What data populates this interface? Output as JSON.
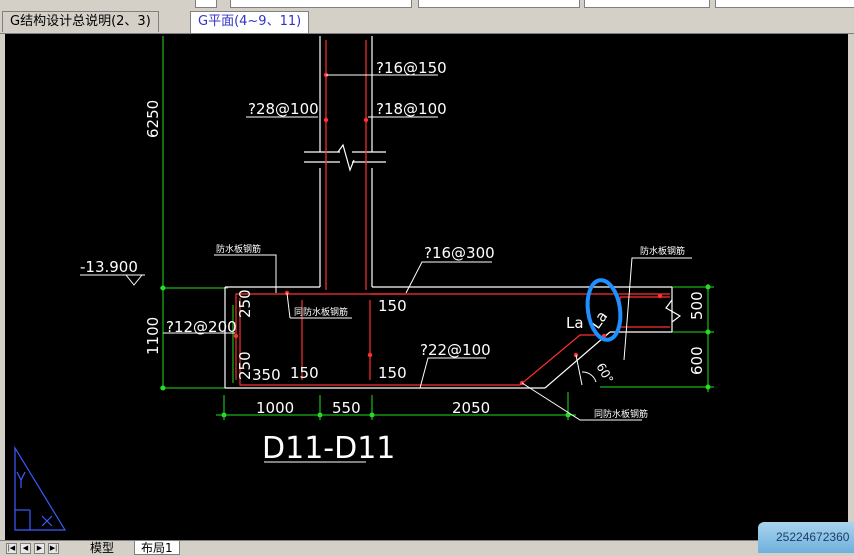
{
  "tabs": [
    {
      "label": "G结构设计总说明(2、3)",
      "active": false
    },
    {
      "label": "G平面(4~9、11)",
      "active": true
    }
  ],
  "drawing": {
    "title": "D11-D11",
    "level": "-13.900",
    "rebar": {
      "r16_150": "?16@150",
      "r28_100": "?28@100",
      "r18_100": "?18@100",
      "r16_300": "?16@300",
      "r12_200": "?12@200",
      "r22_100": "?22@100"
    },
    "dims": {
      "d6250": "6250",
      "d1100": "1100",
      "d250a": "250",
      "d250b": "250",
      "d350": "350",
      "d150a": "150",
      "d150b": "150",
      "d150c": "150",
      "d1000": "1000",
      "d550": "550",
      "d2050": "2050",
      "d500": "500",
      "d600": "600",
      "angle": "60°"
    },
    "labels": {
      "la1": "La",
      "la2": "La",
      "waterproof1": "防水板钢筋",
      "waterproof2": "防水板钢筋",
      "waterproof3": "同防水板钢筋",
      "waterproof4": "同防水板钢筋"
    }
  },
  "bottom_tabs": [
    {
      "label": "模型",
      "active": false
    },
    {
      "label": "布局1",
      "active": true
    }
  ],
  "notice": {
    "text": "25224672360"
  },
  "colors": {
    "accent": "#3333cc",
    "cad_red": "#ff3030",
    "cad_green": "#22dd22",
    "cad_white": "#ffffff",
    "highlight_blue": "#1e90ff"
  }
}
